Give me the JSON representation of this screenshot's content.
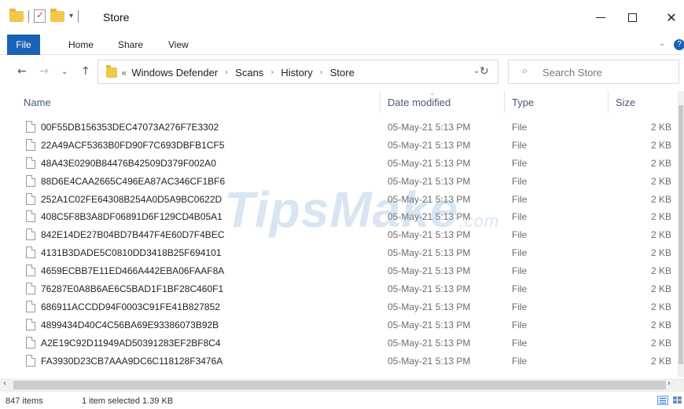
{
  "window": {
    "title": "Store",
    "minimize_icon": "minimize-icon",
    "maximize_icon": "maximize-icon",
    "close_symbol": "✕"
  },
  "ribbon": {
    "tabs": [
      "File",
      "Home",
      "Share",
      "View"
    ],
    "expand_symbol": "⌄",
    "help_symbol": "?"
  },
  "nav": {
    "back_symbol": "←",
    "forward_symbol": "→",
    "recent_symbol": "⌄",
    "up_symbol": "↑",
    "overflow_symbol": "«",
    "breadcrumb": [
      "Windows Defender",
      "Scans",
      "History",
      "Store"
    ],
    "separator_symbol": "›",
    "dropdown_symbol": "⌄",
    "refresh_symbol": "↻"
  },
  "search": {
    "icon_symbol": "⌕",
    "placeholder": "Search Store"
  },
  "columns": {
    "name": "Name",
    "date": "Date modified",
    "type": "Type",
    "size": "Size",
    "sort_symbol": "⌄"
  },
  "files": [
    {
      "name": "00F55DB156353DEC47073A276F7E3302",
      "date": "05-May-21 5:13 PM",
      "type": "File",
      "size": "2 KB"
    },
    {
      "name": "22A49ACF5363B0FD90F7C693DBFB1CF5",
      "date": "05-May-21 5:13 PM",
      "type": "File",
      "size": "2 KB"
    },
    {
      "name": "48A43E0290B84476B42509D379F002A0",
      "date": "05-May-21 5:13 PM",
      "type": "File",
      "size": "2 KB"
    },
    {
      "name": "88D6E4CAA2665C496EA87AC346CF1BF6",
      "date": "05-May-21 5:13 PM",
      "type": "File",
      "size": "2 KB"
    },
    {
      "name": "252A1C02FE64308B254A0D5A9BC0622D",
      "date": "05-May-21 5:13 PM",
      "type": "File",
      "size": "2 KB"
    },
    {
      "name": "408C5F8B3A8DF06891D6F129CD4B05A1",
      "date": "05-May-21 5:13 PM",
      "type": "File",
      "size": "2 KB"
    },
    {
      "name": "842E14DE27B04BD7B447F4E60D7F4BEC",
      "date": "05-May-21 5:13 PM",
      "type": "File",
      "size": "2 KB"
    },
    {
      "name": "4131B3DADE5C0810DD3418B25F694101",
      "date": "05-May-21 5:13 PM",
      "type": "File",
      "size": "2 KB"
    },
    {
      "name": "4659ECBB7E11ED466A442EBA06FAAF8A",
      "date": "05-May-21 5:13 PM",
      "type": "File",
      "size": "2 KB"
    },
    {
      "name": "76287E0A8B6AE6C5BAD1F1BF28C460F1",
      "date": "05-May-21 5:13 PM",
      "type": "File",
      "size": "2 KB"
    },
    {
      "name": "686911ACCDD94F0003C91FE41B827852",
      "date": "05-May-21 5:13 PM",
      "type": "File",
      "size": "2 KB"
    },
    {
      "name": "4899434D40C4C56BA69E93386073B92B",
      "date": "05-May-21 5:13 PM",
      "type": "File",
      "size": "2 KB"
    },
    {
      "name": "A2E19C92D11949AD50391283EF2BF8C4",
      "date": "05-May-21 5:13 PM",
      "type": "File",
      "size": "2 KB"
    },
    {
      "name": "FA3930D23CB7AAA9DC6C118128F3476A",
      "date": "05-May-21 5:13 PM",
      "type": "File",
      "size": "2 KB"
    }
  ],
  "scroll": {
    "left_symbol": "‹",
    "right_symbol": "›"
  },
  "status": {
    "item_count": "847 items",
    "selection": "1 item selected  1.39 KB"
  },
  "watermark": {
    "text": "TipsMake",
    "suffix": ".com"
  },
  "colors": {
    "file_tab": "#1a62b5",
    "folder": "#f1c84b",
    "header_text": "#4a5a75",
    "secondary_text": "#6d6d6d"
  }
}
